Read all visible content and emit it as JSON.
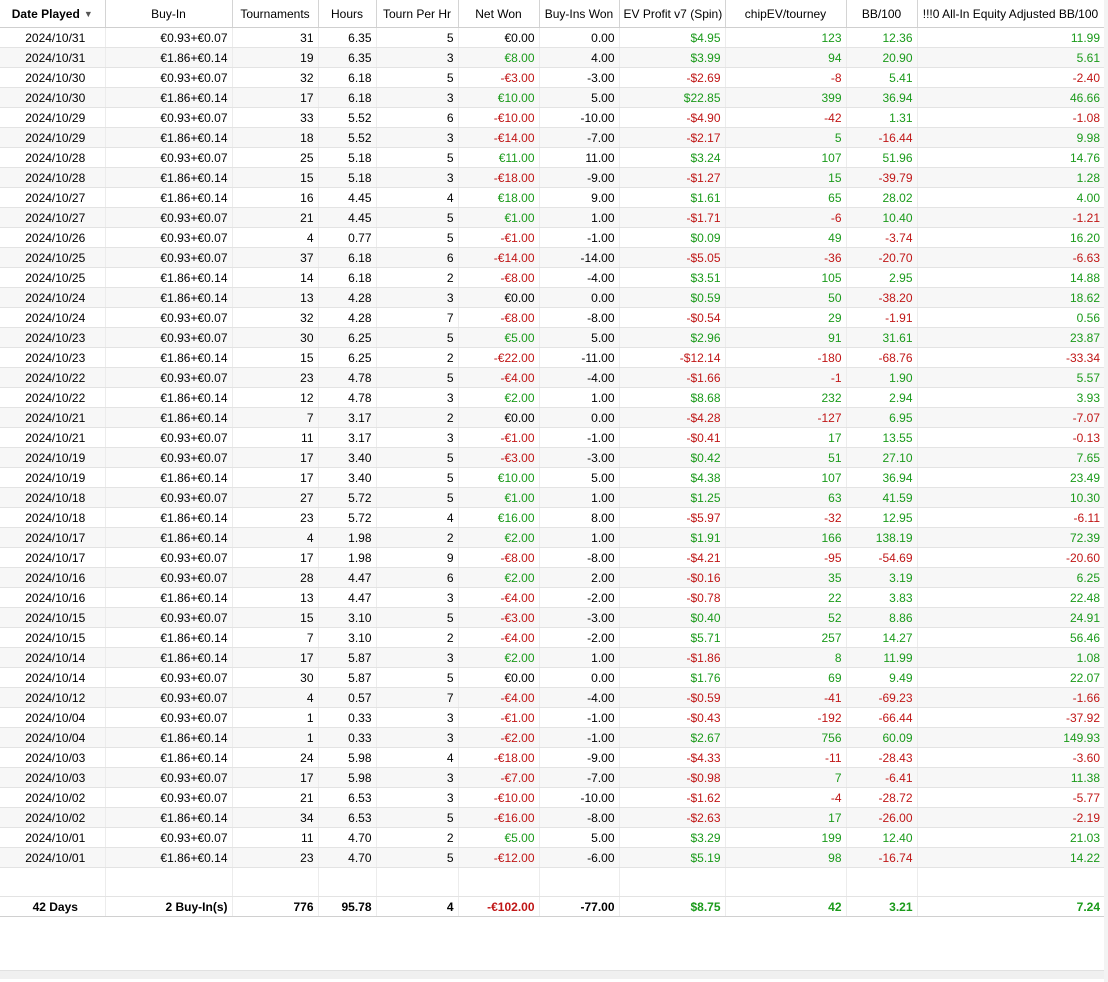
{
  "columns": [
    {
      "key": "date",
      "label": "Date Played",
      "sorted": true
    },
    {
      "key": "buyin",
      "label": "Buy-In"
    },
    {
      "key": "tournaments",
      "label": "Tournaments"
    },
    {
      "key": "hours",
      "label": "Hours"
    },
    {
      "key": "tph",
      "label": "Tourn Per Hr"
    },
    {
      "key": "net",
      "label": "Net Won"
    },
    {
      "key": "bi_won",
      "label": "Buy-Ins Won"
    },
    {
      "key": "ev",
      "label": "EV Profit v7 (Spin)"
    },
    {
      "key": "chipev",
      "label": "chipEV/tourney"
    },
    {
      "key": "bb100",
      "label": "BB/100"
    },
    {
      "key": "aibb",
      "label": "!!!0 All-In Equity Adjusted BB/100"
    }
  ],
  "sort_icon": "chevron-down-icon",
  "colors": {
    "positive": "#1a9a1a",
    "negative": "#c01616"
  },
  "rows": [
    [
      "2024/10/31",
      "€0.93+€0.07",
      "31",
      "6.35",
      "5",
      "€0.00",
      "0.00",
      "$4.95",
      "123",
      "12.36",
      "11.99"
    ],
    [
      "2024/10/31",
      "€1.86+€0.14",
      "19",
      "6.35",
      "3",
      "€8.00",
      "4.00",
      "$3.99",
      "94",
      "20.90",
      "5.61"
    ],
    [
      "2024/10/30",
      "€0.93+€0.07",
      "32",
      "6.18",
      "5",
      "-€3.00",
      "-3.00",
      "-$2.69",
      "-8",
      "5.41",
      "-2.40"
    ],
    [
      "2024/10/30",
      "€1.86+€0.14",
      "17",
      "6.18",
      "3",
      "€10.00",
      "5.00",
      "$22.85",
      "399",
      "36.94",
      "46.66"
    ],
    [
      "2024/10/29",
      "€0.93+€0.07",
      "33",
      "5.52",
      "6",
      "-€10.00",
      "-10.00",
      "-$4.90",
      "-42",
      "1.31",
      "-1.08"
    ],
    [
      "2024/10/29",
      "€1.86+€0.14",
      "18",
      "5.52",
      "3",
      "-€14.00",
      "-7.00",
      "-$2.17",
      "5",
      "-16.44",
      "9.98"
    ],
    [
      "2024/10/28",
      "€0.93+€0.07",
      "25",
      "5.18",
      "5",
      "€11.00",
      "11.00",
      "$3.24",
      "107",
      "51.96",
      "14.76"
    ],
    [
      "2024/10/28",
      "€1.86+€0.14",
      "15",
      "5.18",
      "3",
      "-€18.00",
      "-9.00",
      "-$1.27",
      "15",
      "-39.79",
      "1.28"
    ],
    [
      "2024/10/27",
      "€1.86+€0.14",
      "16",
      "4.45",
      "4",
      "€18.00",
      "9.00",
      "$1.61",
      "65",
      "28.02",
      "4.00"
    ],
    [
      "2024/10/27",
      "€0.93+€0.07",
      "21",
      "4.45",
      "5",
      "€1.00",
      "1.00",
      "-$1.71",
      "-6",
      "10.40",
      "-1.21"
    ],
    [
      "2024/10/26",
      "€0.93+€0.07",
      "4",
      "0.77",
      "5",
      "-€1.00",
      "-1.00",
      "$0.09",
      "49",
      "-3.74",
      "16.20"
    ],
    [
      "2024/10/25",
      "€0.93+€0.07",
      "37",
      "6.18",
      "6",
      "-€14.00",
      "-14.00",
      "-$5.05",
      "-36",
      "-20.70",
      "-6.63"
    ],
    [
      "2024/10/25",
      "€1.86+€0.14",
      "14",
      "6.18",
      "2",
      "-€8.00",
      "-4.00",
      "$3.51",
      "105",
      "2.95",
      "14.88"
    ],
    [
      "2024/10/24",
      "€1.86+€0.14",
      "13",
      "4.28",
      "3",
      "€0.00",
      "0.00",
      "$0.59",
      "50",
      "-38.20",
      "18.62"
    ],
    [
      "2024/10/24",
      "€0.93+€0.07",
      "32",
      "4.28",
      "7",
      "-€8.00",
      "-8.00",
      "-$0.54",
      "29",
      "-1.91",
      "0.56"
    ],
    [
      "2024/10/23",
      "€0.93+€0.07",
      "30",
      "6.25",
      "5",
      "€5.00",
      "5.00",
      "$2.96",
      "91",
      "31.61",
      "23.87"
    ],
    [
      "2024/10/23",
      "€1.86+€0.14",
      "15",
      "6.25",
      "2",
      "-€22.00",
      "-11.00",
      "-$12.14",
      "-180",
      "-68.76",
      "-33.34"
    ],
    [
      "2024/10/22",
      "€0.93+€0.07",
      "23",
      "4.78",
      "5",
      "-€4.00",
      "-4.00",
      "-$1.66",
      "-1",
      "1.90",
      "5.57"
    ],
    [
      "2024/10/22",
      "€1.86+€0.14",
      "12",
      "4.78",
      "3",
      "€2.00",
      "1.00",
      "$8.68",
      "232",
      "2.94",
      "3.93"
    ],
    [
      "2024/10/21",
      "€1.86+€0.14",
      "7",
      "3.17",
      "2",
      "€0.00",
      "0.00",
      "-$4.28",
      "-127",
      "6.95",
      "-7.07"
    ],
    [
      "2024/10/21",
      "€0.93+€0.07",
      "11",
      "3.17",
      "3",
      "-€1.00",
      "-1.00",
      "-$0.41",
      "17",
      "13.55",
      "-0.13"
    ],
    [
      "2024/10/19",
      "€0.93+€0.07",
      "17",
      "3.40",
      "5",
      "-€3.00",
      "-3.00",
      "$0.42",
      "51",
      "27.10",
      "7.65"
    ],
    [
      "2024/10/19",
      "€1.86+€0.14",
      "17",
      "3.40",
      "5",
      "€10.00",
      "5.00",
      "$4.38",
      "107",
      "36.94",
      "23.49"
    ],
    [
      "2024/10/18",
      "€0.93+€0.07",
      "27",
      "5.72",
      "5",
      "€1.00",
      "1.00",
      "$1.25",
      "63",
      "41.59",
      "10.30"
    ],
    [
      "2024/10/18",
      "€1.86+€0.14",
      "23",
      "5.72",
      "4",
      "€16.00",
      "8.00",
      "-$5.97",
      "-32",
      "12.95",
      "-6.11"
    ],
    [
      "2024/10/17",
      "€1.86+€0.14",
      "4",
      "1.98",
      "2",
      "€2.00",
      "1.00",
      "$1.91",
      "166",
      "138.19",
      "72.39"
    ],
    [
      "2024/10/17",
      "€0.93+€0.07",
      "17",
      "1.98",
      "9",
      "-€8.00",
      "-8.00",
      "-$4.21",
      "-95",
      "-54.69",
      "-20.60"
    ],
    [
      "2024/10/16",
      "€0.93+€0.07",
      "28",
      "4.47",
      "6",
      "€2.00",
      "2.00",
      "-$0.16",
      "35",
      "3.19",
      "6.25"
    ],
    [
      "2024/10/16",
      "€1.86+€0.14",
      "13",
      "4.47",
      "3",
      "-€4.00",
      "-2.00",
      "-$0.78",
      "22",
      "3.83",
      "22.48"
    ],
    [
      "2024/10/15",
      "€0.93+€0.07",
      "15",
      "3.10",
      "5",
      "-€3.00",
      "-3.00",
      "$0.40",
      "52",
      "8.86",
      "24.91"
    ],
    [
      "2024/10/15",
      "€1.86+€0.14",
      "7",
      "3.10",
      "2",
      "-€4.00",
      "-2.00",
      "$5.71",
      "257",
      "14.27",
      "56.46"
    ],
    [
      "2024/10/14",
      "€1.86+€0.14",
      "17",
      "5.87",
      "3",
      "€2.00",
      "1.00",
      "-$1.86",
      "8",
      "11.99",
      "1.08"
    ],
    [
      "2024/10/14",
      "€0.93+€0.07",
      "30",
      "5.87",
      "5",
      "€0.00",
      "0.00",
      "$1.76",
      "69",
      "9.49",
      "22.07"
    ],
    [
      "2024/10/12",
      "€0.93+€0.07",
      "4",
      "0.57",
      "7",
      "-€4.00",
      "-4.00",
      "-$0.59",
      "-41",
      "-69.23",
      "-1.66"
    ],
    [
      "2024/10/04",
      "€0.93+€0.07",
      "1",
      "0.33",
      "3",
      "-€1.00",
      "-1.00",
      "-$0.43",
      "-192",
      "-66.44",
      "-37.92"
    ],
    [
      "2024/10/04",
      "€1.86+€0.14",
      "1",
      "0.33",
      "3",
      "-€2.00",
      "-1.00",
      "$2.67",
      "756",
      "60.09",
      "149.93"
    ],
    [
      "2024/10/03",
      "€1.86+€0.14",
      "24",
      "5.98",
      "4",
      "-€18.00",
      "-9.00",
      "-$4.33",
      "-11",
      "-28.43",
      "-3.60"
    ],
    [
      "2024/10/03",
      "€0.93+€0.07",
      "17",
      "5.98",
      "3",
      "-€7.00",
      "-7.00",
      "-$0.98",
      "7",
      "-6.41",
      "11.38"
    ],
    [
      "2024/10/02",
      "€0.93+€0.07",
      "21",
      "6.53",
      "3",
      "-€10.00",
      "-10.00",
      "-$1.62",
      "-4",
      "-28.72",
      "-5.77"
    ],
    [
      "2024/10/02",
      "€1.86+€0.14",
      "34",
      "6.53",
      "5",
      "-€16.00",
      "-8.00",
      "-$2.63",
      "17",
      "-26.00",
      "-2.19"
    ],
    [
      "2024/10/01",
      "€0.93+€0.07",
      "11",
      "4.70",
      "2",
      "€5.00",
      "5.00",
      "$3.29",
      "199",
      "12.40",
      "21.03"
    ],
    [
      "2024/10/01",
      "€1.86+€0.14",
      "23",
      "4.70",
      "5",
      "-€12.00",
      "-6.00",
      "$5.19",
      "98",
      "-16.74",
      "14.22"
    ]
  ],
  "totals": [
    "42 Days",
    "2 Buy-In(s)",
    "776",
    "95.78",
    "4",
    "-€102.00",
    "-77.00",
    "$8.75",
    "42",
    "3.21",
    "7.24"
  ]
}
